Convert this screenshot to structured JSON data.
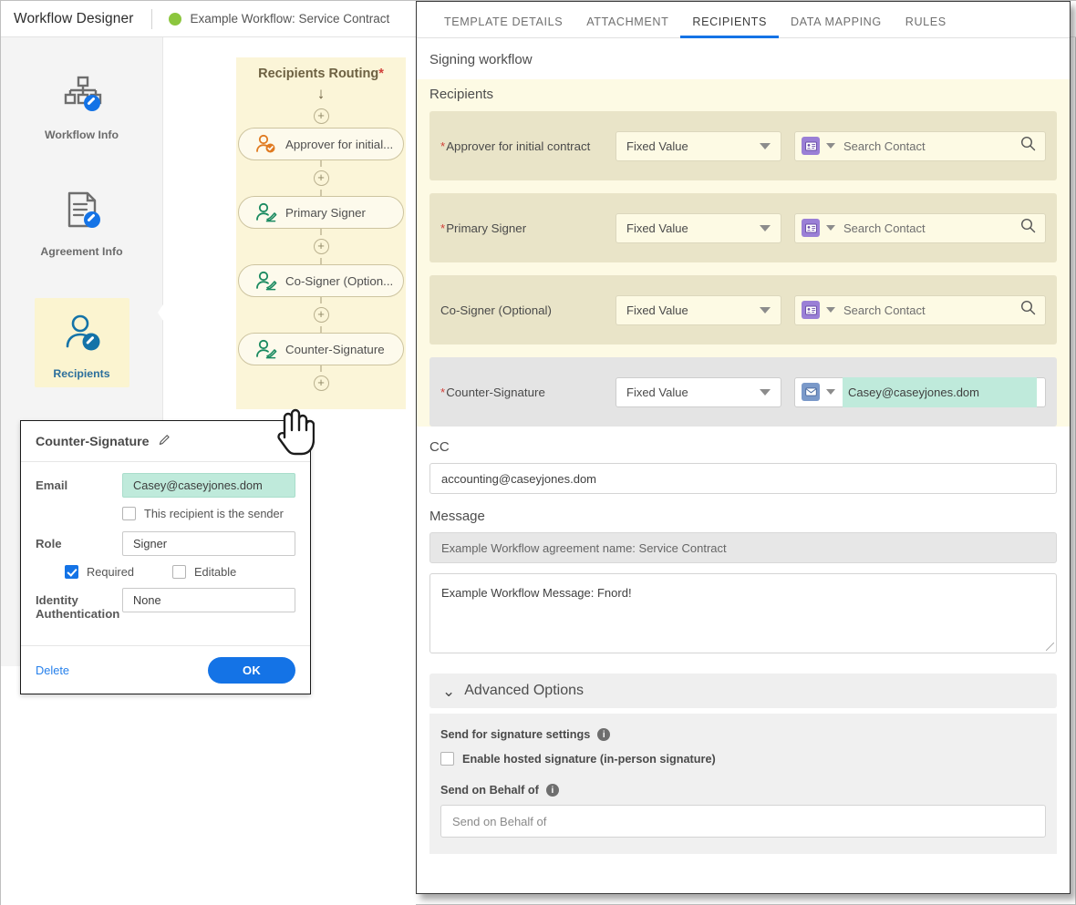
{
  "topbar": {
    "app_title": "Workflow Designer",
    "workflow_name": "Example Workflow: Service Contract",
    "status_color": "#8cc63e"
  },
  "sidebar": {
    "items": [
      {
        "label": "Workflow Info",
        "icon": "org-chart-icon",
        "active": false
      },
      {
        "label": "Agreement Info",
        "icon": "document-edit-icon",
        "active": false
      },
      {
        "label": "Recipients",
        "icon": "person-edit-icon",
        "active": true
      },
      {
        "label": "",
        "icon": "briefcase-icon",
        "active": false
      }
    ]
  },
  "routing": {
    "title": "Recipients Routing",
    "required_marker": "*",
    "nodes": [
      {
        "label": "Approver for initial...",
        "icon": "approver-icon",
        "color": "#e07b21"
      },
      {
        "label": "Primary Signer",
        "icon": "signer-icon",
        "color": "#1a8a60"
      },
      {
        "label": "Co-Signer (Option...",
        "icon": "signer-icon",
        "color": "#1a8a60"
      },
      {
        "label": "Counter-Signature",
        "icon": "signer-icon",
        "color": "#1a8a60"
      }
    ],
    "add_node_glyph": "+"
  },
  "popup": {
    "title": "Counter-Signature",
    "edit_icon": "pencil-icon",
    "email_label": "Email",
    "email_value": "Casey@caseyjones.dom",
    "sender_checkbox_label": "This recipient is the sender",
    "sender_checked": false,
    "role_label": "Role",
    "role_value": "Signer",
    "required_label": "Required",
    "required_checked": true,
    "editable_label": "Editable",
    "editable_checked": false,
    "identity_label": "Identity Authentication",
    "identity_value": "None",
    "delete_label": "Delete",
    "ok_label": "OK",
    "accent_color": "#1473e6",
    "highlight_color": "#bfeadb"
  },
  "right_panel": {
    "tabs": [
      {
        "label": "TEMPLATE DETAILS",
        "active": false
      },
      {
        "label": "ATTACHMENT",
        "active": false
      },
      {
        "label": "RECIPIENTS",
        "active": true
      },
      {
        "label": "DATA MAPPING",
        "active": false
      },
      {
        "label": "RULES",
        "active": false
      }
    ],
    "signing_workflow_title": "Signing workflow",
    "recipients_title": "Recipients",
    "search_icon": "search-icon",
    "recipients": [
      {
        "name": "Approver for initial contract",
        "required": true,
        "source_value": "Fixed Value",
        "badge_icon": "contact-card-icon",
        "badge_kind": "card",
        "contact_value": "",
        "contact_placeholder": "Search Contact",
        "highlighted": false,
        "style": "yellow"
      },
      {
        "name": "Primary Signer",
        "required": true,
        "source_value": "Fixed Value",
        "badge_icon": "contact-card-icon",
        "badge_kind": "card",
        "contact_value": "",
        "contact_placeholder": "Search Contact",
        "highlighted": false,
        "style": "yellow"
      },
      {
        "name": "Co-Signer (Optional)",
        "required": false,
        "source_value": "Fixed Value",
        "badge_icon": "contact-card-icon",
        "badge_kind": "card",
        "contact_value": "",
        "contact_placeholder": "Search Contact",
        "highlighted": false,
        "style": "yellow"
      },
      {
        "name": "Counter-Signature",
        "required": true,
        "source_value": "Fixed Value",
        "badge_icon": "envelope-icon",
        "badge_kind": "mail",
        "contact_value": "Casey@caseyjones.dom",
        "contact_placeholder": "",
        "highlighted": true,
        "style": "grey"
      }
    ],
    "cc": {
      "label": "CC",
      "value": "accounting@caseyjones.dom"
    },
    "message": {
      "label": "Message",
      "subject_value": "Example Workflow agreement name: Service Contract",
      "body_value": "Example Workflow Message: Fnord!"
    },
    "advanced": {
      "title": "Advanced Options",
      "chevron": "chevron-down-icon",
      "send_settings_label": "Send for signature settings",
      "hosted_signature_label": "Enable hosted signature (in-person signature)",
      "hosted_signature_checked": false,
      "send_on_behalf_label": "Send on Behalf of",
      "send_on_behalf_placeholder": "Send on Behalf of",
      "info_glyph": "i"
    }
  }
}
